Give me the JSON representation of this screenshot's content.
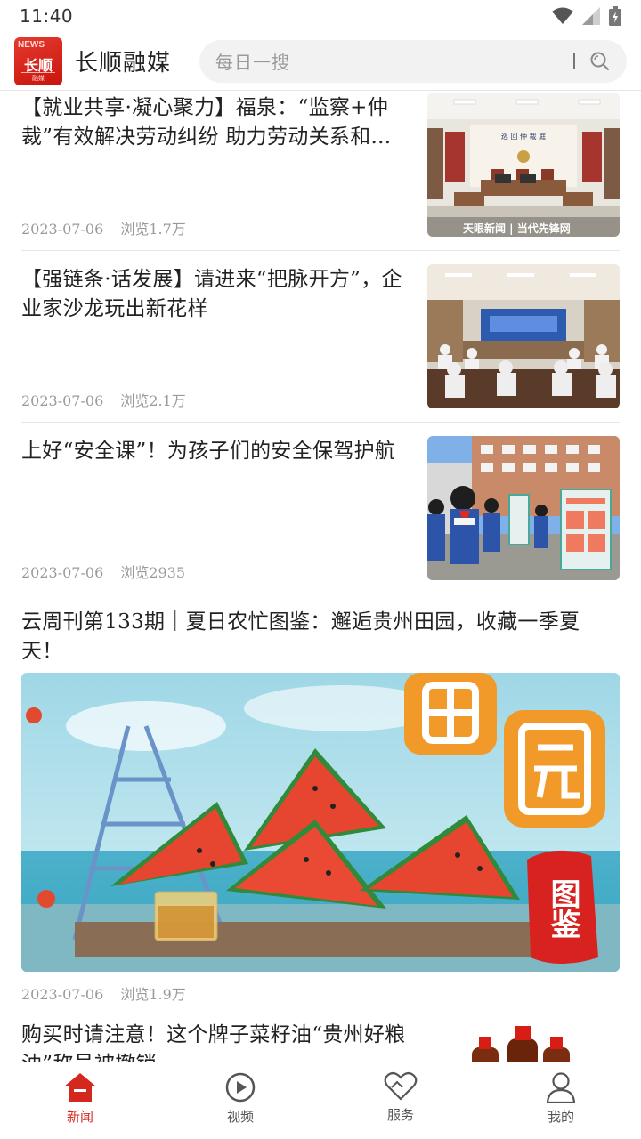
{
  "status_bar": {
    "time": "11:40"
  },
  "header": {
    "logo": {
      "badge": "NEWS",
      "text": "长顺",
      "subtext": "融媒"
    },
    "app_name": "长顺融媒",
    "search": {
      "placeholder": "每日一搜"
    }
  },
  "feed": [
    {
      "title": "【就业共享·凝心聚力】福泉：“监察+仲裁”有效解决劳动纠纷 助力劳动关系和...",
      "date": "2023-07-06",
      "views": "浏览1.7万",
      "image": "courtroom-photo",
      "image_text": {
        "sign": "巡 回 仲 裁 庭",
        "watermark": "天眼新闻 | 当代先锋网"
      }
    },
    {
      "title": "【强链条·话发展】请进来“把脉开方”，企业家沙龙玩出新花样",
      "date": "2023-07-06",
      "views": "浏览2.1万",
      "image": "conference-hall-photo"
    },
    {
      "title": "上好“安全课”！为孩子们的安全保驾护航",
      "date": "2023-07-06",
      "views": "浏览2935",
      "image": "students-safety-photo"
    },
    {
      "title": "云周刊第133期｜夏日农忙图鉴：邂逅贵州田园，收藏一季夏天！",
      "date": "2023-07-06",
      "views": "浏览1.9万",
      "image": "watermelon-illustration",
      "image_text": {
        "char1": "田",
        "char2": "园",
        "stamp": "图鉴"
      }
    },
    {
      "title": "购买时请注意！这个牌子菜籽油“贵州好粮油”称号被撤销",
      "image": "oil-bottles-photo"
    }
  ],
  "tab_bar": [
    {
      "label": "新闻",
      "icon": "home-icon",
      "active": true
    },
    {
      "label": "视频",
      "icon": "play-icon",
      "active": false
    },
    {
      "label": "服务",
      "icon": "heart-icon",
      "active": false
    },
    {
      "label": "我的",
      "icon": "person-icon",
      "active": false
    }
  ],
  "colors": {
    "accent": "#d4271e",
    "divider": "#e6e6e6",
    "meta": "#9a9a9a"
  }
}
